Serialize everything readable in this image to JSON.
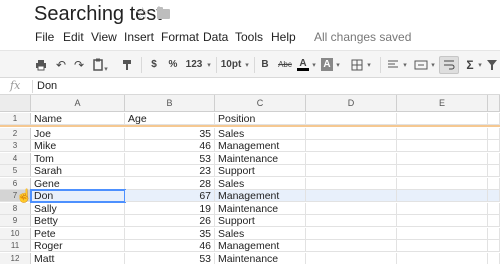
{
  "document": {
    "title": "Searching test"
  },
  "menu": {
    "items": [
      "File",
      "Edit",
      "View",
      "Insert",
      "Format",
      "Data",
      "Tools",
      "Help"
    ],
    "save_status": "All changes saved"
  },
  "toolbar": {
    "currency": "$",
    "percent": "%",
    "number_format": "123",
    "font_size": "10pt",
    "bold": "B",
    "strikethrough": "Abc",
    "text_color": "A",
    "fill_color": "A",
    "function": "Σ"
  },
  "formula_bar": {
    "label": "fx",
    "value": "Don"
  },
  "columns": [
    "A",
    "B",
    "C",
    "D",
    "E"
  ],
  "rows": [
    {
      "num": "1",
      "name": "Name",
      "age": "Age",
      "position": "Position",
      "is_header": true
    },
    {
      "num": "2",
      "name": "Joe",
      "age": "35",
      "position": "Sales"
    },
    {
      "num": "3",
      "name": "Mike",
      "age": "46",
      "position": "Management"
    },
    {
      "num": "4",
      "name": "Tom",
      "age": "53",
      "position": "Maintenance"
    },
    {
      "num": "5",
      "name": "Sarah",
      "age": "23",
      "position": "Support"
    },
    {
      "num": "6",
      "name": "Gene",
      "age": "28",
      "position": "Sales"
    },
    {
      "num": "7",
      "name": "Don",
      "age": "67",
      "position": "Management",
      "selected": true
    },
    {
      "num": "8",
      "name": "Sally",
      "age": "19",
      "position": "Maintenance"
    },
    {
      "num": "9",
      "name": "Betty",
      "age": "26",
      "position": "Support"
    },
    {
      "num": "10",
      "name": "Pete",
      "age": "35",
      "position": "Sales"
    },
    {
      "num": "11",
      "name": "Roger",
      "age": "46",
      "position": "Management"
    },
    {
      "num": "12",
      "name": "Matt",
      "age": "53",
      "position": "Maintenance"
    }
  ]
}
